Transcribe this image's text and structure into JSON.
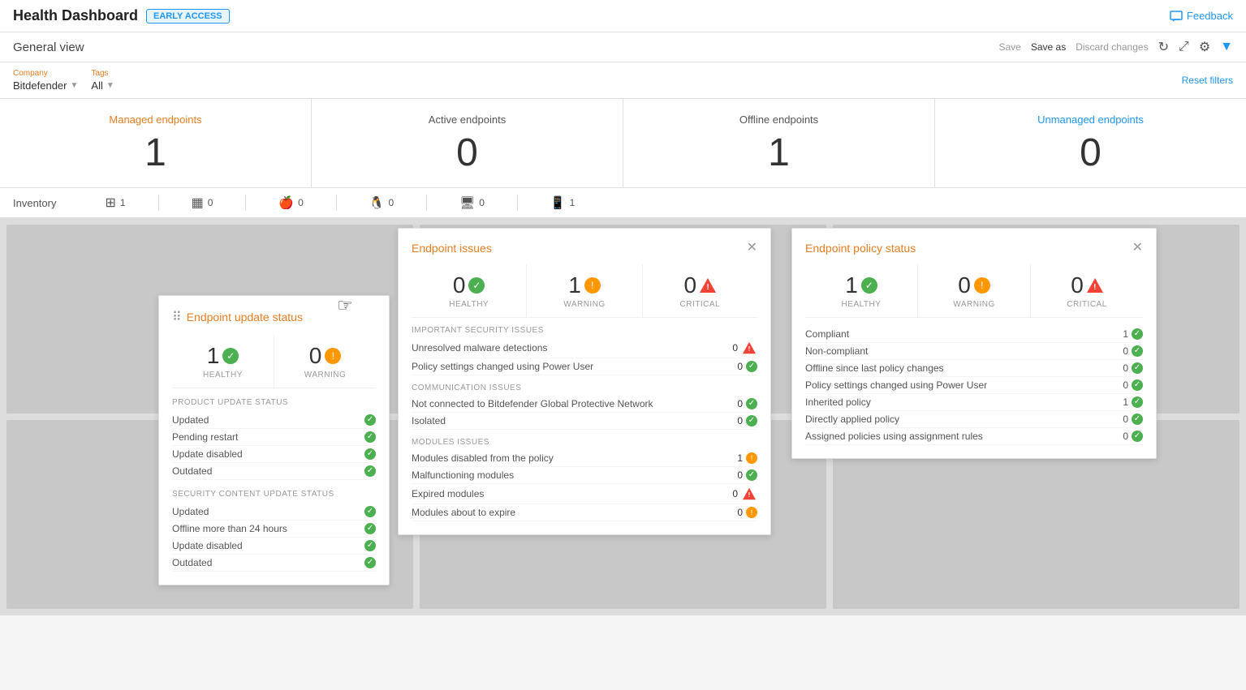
{
  "header": {
    "title": "Health Dashboard",
    "badge": "EARLY ACCESS",
    "feedback": "Feedback"
  },
  "toolbar": {
    "general_view": "General view",
    "save": "Save",
    "save_as": "Save as",
    "discard": "Discard changes",
    "reset_filters": "Reset filters"
  },
  "filters": {
    "company_label": "Company",
    "company_value": "Bitdefender",
    "tags_label": "Tags",
    "tags_value": "All"
  },
  "endpoints": {
    "managed": {
      "label": "Managed endpoints",
      "count": "1"
    },
    "active": {
      "label": "Active endpoints",
      "count": "0"
    },
    "offline": {
      "label": "Offline endpoints",
      "count": "1"
    },
    "unmanaged": {
      "label": "Unmanaged endpoints",
      "count": "0"
    }
  },
  "inventory": {
    "label": "Inventory",
    "items": [
      {
        "os": "Windows",
        "count": "1"
      },
      {
        "os": "Windows Server",
        "count": "0"
      },
      {
        "os": "macOS",
        "count": "0"
      },
      {
        "os": "Linux",
        "count": "0"
      },
      {
        "os": "Monitor",
        "count": "0"
      },
      {
        "os": "Mobile",
        "count": "1"
      }
    ]
  },
  "endpoint_update_status": {
    "title": "Endpoint update status",
    "healthy_count": "1",
    "healthy_label": "HEALTHY",
    "warning_count": "0",
    "warning_label": "WARNING",
    "product_update_section": "PRODUCT UPDATE STATUS",
    "product_items": [
      {
        "label": "Updated",
        "value": ""
      },
      {
        "label": "Pending restart",
        "value": ""
      },
      {
        "label": "Update disabled",
        "value": ""
      },
      {
        "label": "Outdated",
        "value": ""
      }
    ],
    "security_content_section": "SECURITY CONTENT UPDATE STATUS",
    "security_items": [
      {
        "label": "Updated",
        "value": ""
      },
      {
        "label": "Offline more than 24 hours",
        "value": ""
      },
      {
        "label": "Update disabled",
        "value": ""
      },
      {
        "label": "Outdated",
        "value": ""
      }
    ]
  },
  "endpoint_issues": {
    "title": "Endpoint issues",
    "healthy_count": "0",
    "healthy_label": "HEALTHY",
    "warning_count": "1",
    "warning_label": "WARNING",
    "critical_count": "0",
    "critical_label": "CRITICAL",
    "important_security_section": "IMPORTANT SECURITY ISSUES",
    "security_items": [
      {
        "label": "Unresolved malware detections",
        "value": "0",
        "icon": "crit"
      },
      {
        "label": "Policy settings changed using Power User",
        "value": "0",
        "icon": "check"
      }
    ],
    "communication_section": "COMMUNICATION ISSUES",
    "communication_items": [
      {
        "label": "Not connected to Bitdefender Global Protective Network",
        "value": "0",
        "icon": "check"
      },
      {
        "label": "Isolated",
        "value": "0",
        "icon": "check"
      }
    ],
    "modules_section": "MODULES ISSUES",
    "modules_items": [
      {
        "label": "Modules disabled from the policy",
        "value": "1",
        "icon": "warn"
      },
      {
        "label": "Malfunctioning modules",
        "value": "0",
        "icon": "check"
      },
      {
        "label": "Expired modules",
        "value": "0",
        "icon": "crit"
      },
      {
        "label": "Modules about to expire",
        "value": "0",
        "icon": "warn"
      }
    ]
  },
  "endpoint_policy": {
    "title": "Endpoint policy status",
    "healthy_count": "1",
    "healthy_label": "HEALTHY",
    "warning_count": "0",
    "warning_label": "WARNING",
    "critical_count": "0",
    "critical_label": "CRITICAL",
    "items": [
      {
        "label": "Compliant",
        "value": "1",
        "icon": "check"
      },
      {
        "label": "Non-compliant",
        "value": "0",
        "icon": "check"
      },
      {
        "label": "Offline since last policy changes",
        "value": "0",
        "icon": "check"
      },
      {
        "label": "Policy settings changed using Power User",
        "value": "0",
        "icon": "check"
      },
      {
        "label": "Inherited policy",
        "value": "1",
        "icon": "check"
      },
      {
        "label": "Directly applied policy",
        "value": "0",
        "icon": "check"
      },
      {
        "label": "Assigned policies using assignment rules",
        "value": "0",
        "icon": "check"
      }
    ]
  },
  "colors": {
    "orange": "#e67e22",
    "blue": "#2196f3",
    "green": "#4caf50",
    "warning": "#ff9800",
    "critical": "#f44336"
  }
}
